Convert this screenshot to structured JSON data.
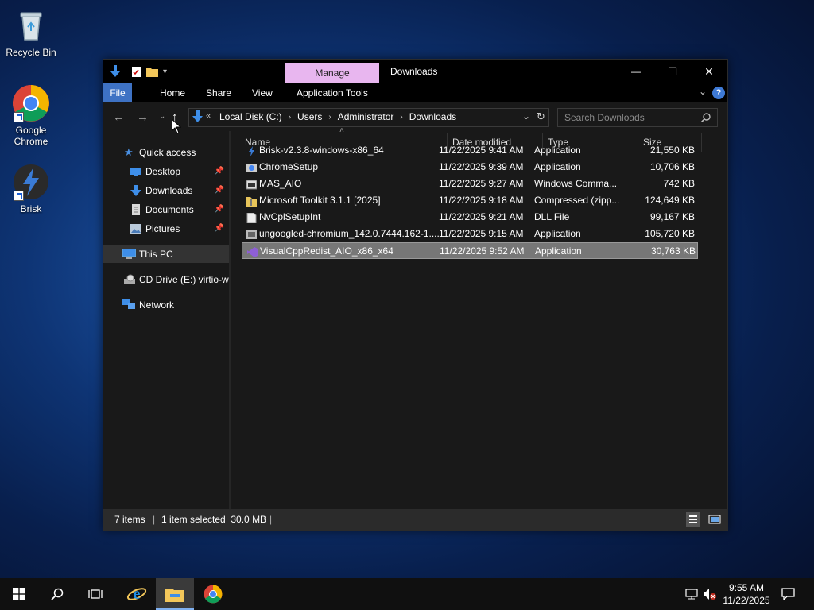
{
  "desktop": {
    "icons": [
      {
        "label": "Recycle Bin",
        "icon": "recycle-bin-icon"
      },
      {
        "label": "Google Chrome",
        "icon": "chrome-icon"
      },
      {
        "label": "Brisk",
        "icon": "brisk-icon"
      }
    ]
  },
  "window": {
    "title": "Downloads",
    "contextual_tab": "Manage",
    "ribbon_tabs": [
      "File",
      "Home",
      "Share",
      "View",
      "Application Tools"
    ],
    "address": {
      "chevron": "«",
      "crumbs": [
        "Local Disk (C:)",
        "Users",
        "Administrator",
        "Downloads"
      ]
    },
    "search_placeholder": "Search Downloads",
    "controls": {
      "minimize": "—",
      "maximize": "☐",
      "close": "✕"
    }
  },
  "navpane": {
    "quick_access": "Quick access",
    "pinned": [
      "Desktop",
      "Downloads",
      "Documents",
      "Pictures"
    ],
    "this_pc": "This PC",
    "cd_drive": "CD Drive (E:) virtio-w",
    "network": "Network"
  },
  "filelist": {
    "columns": [
      "Name",
      "Date modified",
      "Type",
      "Size"
    ],
    "rows": [
      {
        "name": "Brisk-v2.3.8-windows-x86_64",
        "date": "11/22/2025 9:41 AM",
        "type": "Application",
        "size": "21,550 KB",
        "icon": "brisk-app-icon"
      },
      {
        "name": "ChromeSetup",
        "date": "11/22/2025 9:39 AM",
        "type": "Application",
        "size": "10,706 KB",
        "icon": "setup-app-icon"
      },
      {
        "name": "MAS_AIO",
        "date": "11/22/2025 9:27 AM",
        "type": "Windows Comma...",
        "size": "742 KB",
        "icon": "cmd-script-icon"
      },
      {
        "name": "Microsoft Toolkit 3.1.1 [2025]",
        "date": "11/22/2025 9:18 AM",
        "type": "Compressed (zipp...",
        "size": "124,649 KB",
        "icon": "zip-folder-icon"
      },
      {
        "name": "NvCplSetupInt",
        "date": "11/22/2025 9:21 AM",
        "type": "DLL File",
        "size": "99,167 KB",
        "icon": "dll-file-icon"
      },
      {
        "name": "ungoogled-chromium_142.0.7444.162-1....",
        "date": "11/22/2025 9:15 AM",
        "type": "Application",
        "size": "105,720 KB",
        "icon": "installer-app-icon"
      },
      {
        "name": "VisualCppRedist_AIO_x86_x64",
        "date": "11/22/2025 9:52 AM",
        "type": "Application",
        "size": "30,763 KB",
        "icon": "vs-app-icon"
      }
    ],
    "selected_index": 6
  },
  "statusbar": {
    "items": "7 items",
    "selection": "1 item selected  30.0 MB"
  },
  "taskbar": {
    "time": "9:55 AM",
    "date": "11/22/2025"
  },
  "colors": {
    "accent": "#3e72c4",
    "manage_tab": "#e8b6ef",
    "selected_row": "#777777"
  }
}
